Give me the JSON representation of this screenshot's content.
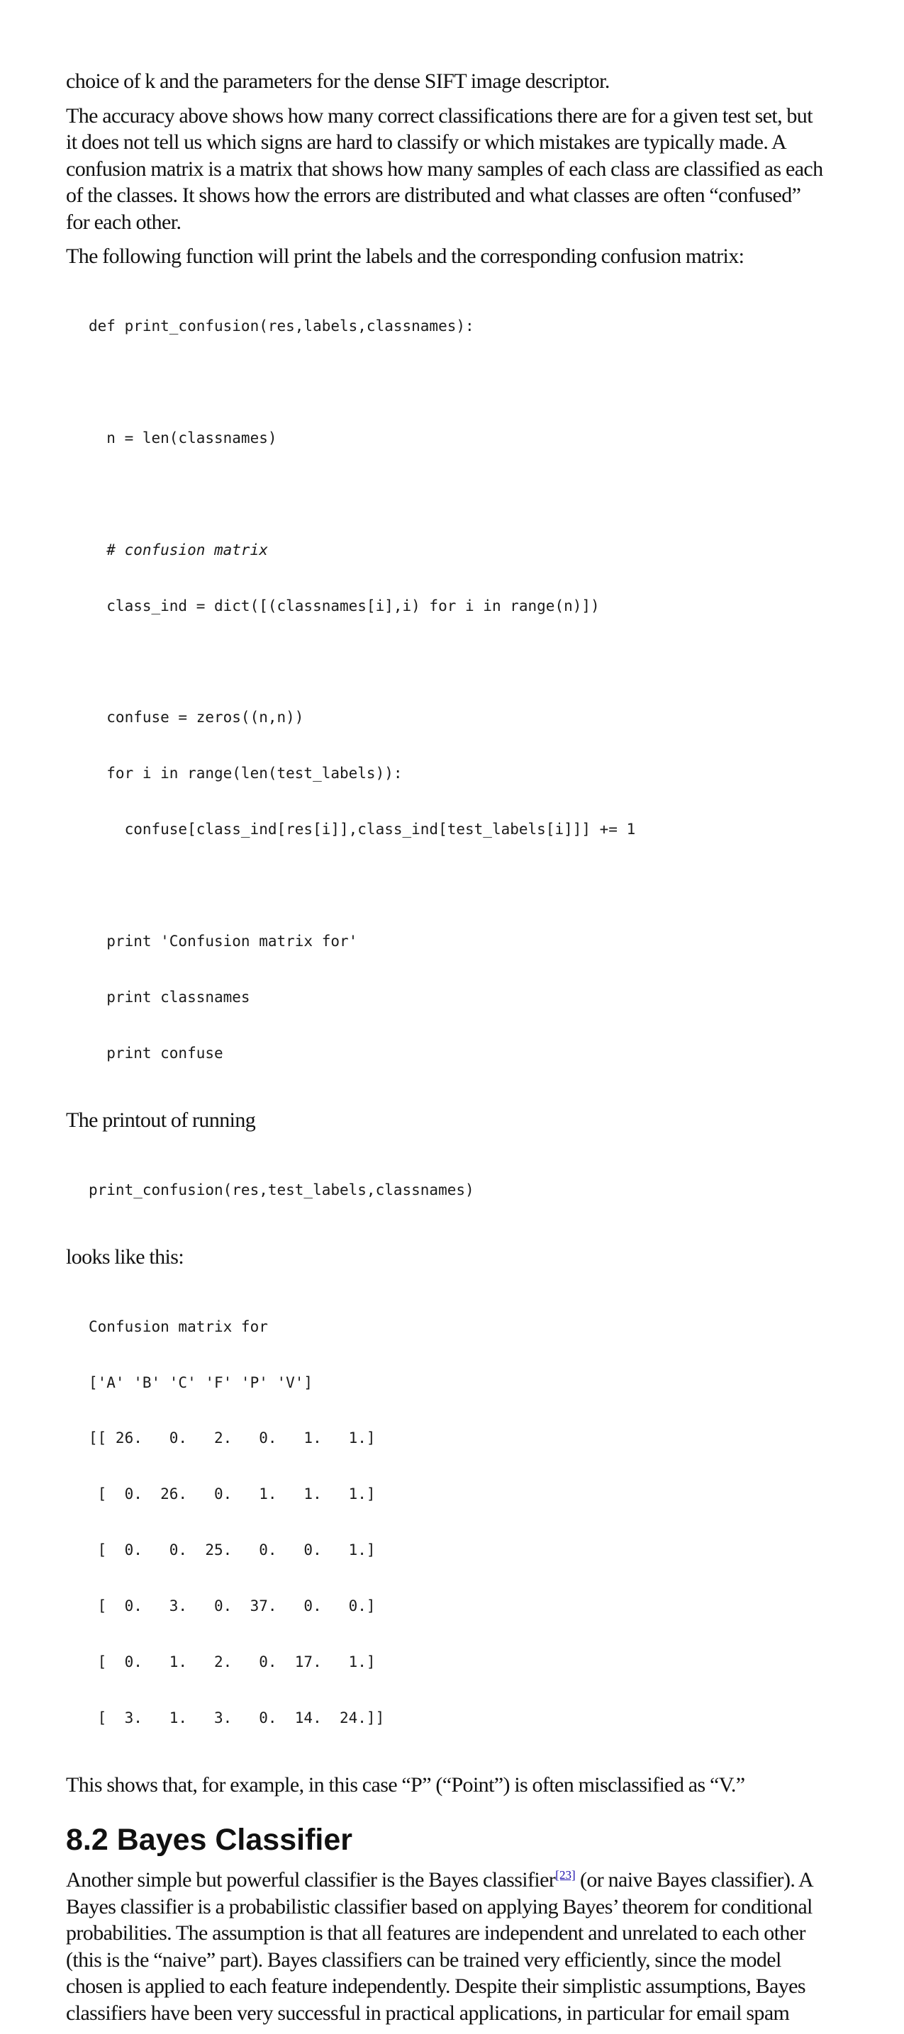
{
  "intro": {
    "line1": "choice of k and the parameters for the dense SIFT image descriptor."
  },
  "confusion_intro": {
    "lines": [
      "The accuracy above shows how many correct classifications there are for a given test set, but",
      "it does not tell us which signs are hard to classify or which mistakes are typically made. A",
      "confusion matrix is a matrix that shows how many samples of each class are classified as each",
      "of the classes. It shows how the errors are distributed and what classes are often “confused”",
      "for each other."
    ]
  },
  "function_intro": "The following function will print the labels and the corresponding confusion matrix:",
  "code_function": {
    "def_line": "def print_confusion(res,labels,classnames):",
    "n_line": "  n = len(classnames)",
    "comment_line": "  # confusion matrix",
    "class_ind_line": "  class_ind = dict([(classnames[i],i) for i in range(n)])",
    "confuse_line": "  confuse = zeros((n,n))",
    "for_line": "  for i in range(len(test_labels)):",
    "inner_line": "    confuse[class_ind[res[i]],class_ind[test_labels[i]]] += 1",
    "print1": "  print 'Confusion matrix for'",
    "print2": "  print classnames",
    "print3": "  print confuse"
  },
  "printout_intro": "The printout of running",
  "code_call": "print_confusion(res,test_labels,classnames)",
  "looks_like": "looks like this:",
  "code_output": {
    "lines": [
      "Confusion matrix for",
      "['A' 'B' 'C' 'F' 'P' 'V']",
      "[[ 26.   0.   2.   0.   1.   1.]",
      " [  0.  26.   0.   1.   1.   1.]",
      " [  0.   0.  25.   0.   0.   1.]",
      " [  0.   3.   0.  37.   0.   0.]",
      " [  0.   1.   2.   0.  17.   1.]",
      " [  3.   1.   3.   0.  14.  24.]]"
    ]
  },
  "conclusion": "This shows that, for example, in this case “P” (“Point”) is often misclassified as “V.”",
  "section": {
    "heading": "8.2 Bayes Classifier",
    "line1_before": "Another simple but powerful classifier is the Bayes classifier",
    "footnote": "[23]",
    "line1_after": " (or naive Bayes classifier). A",
    "lines": [
      "Bayes classifier is a probabilistic classifier based on applying Bayes’ theorem for conditional",
      "probabilities. The assumption is that all features are independent and unrelated to each other",
      "(this is the “naive” part). Bayes classifiers can be trained very efficiently, since the model",
      "chosen is applied to each feature independently. Despite their simplistic assumptions, Bayes",
      "classifiers have been very successful in practical applications, in particular for email spam"
    ]
  }
}
